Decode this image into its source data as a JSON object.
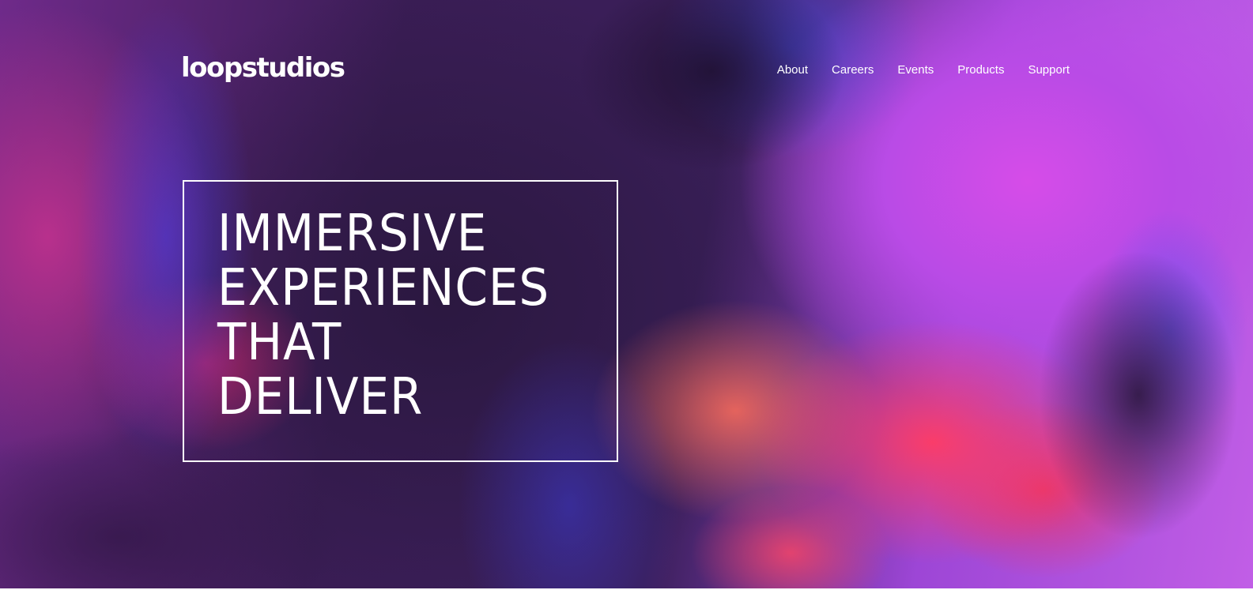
{
  "brand": {
    "logo_text": "loopstudios"
  },
  "nav": {
    "items": [
      {
        "label": "About"
      },
      {
        "label": "Careers"
      },
      {
        "label": "Events"
      },
      {
        "label": "Products"
      },
      {
        "label": "Support"
      }
    ]
  },
  "hero": {
    "headline_lines": [
      "IMMERSIVE",
      "EXPERIENCES",
      "THAT",
      "DELIVER"
    ],
    "text_color": "#ffffff",
    "background_accent_colors": [
      "#c15ee6",
      "#ff3c64",
      "#463ce6",
      "#2b1840"
    ]
  }
}
